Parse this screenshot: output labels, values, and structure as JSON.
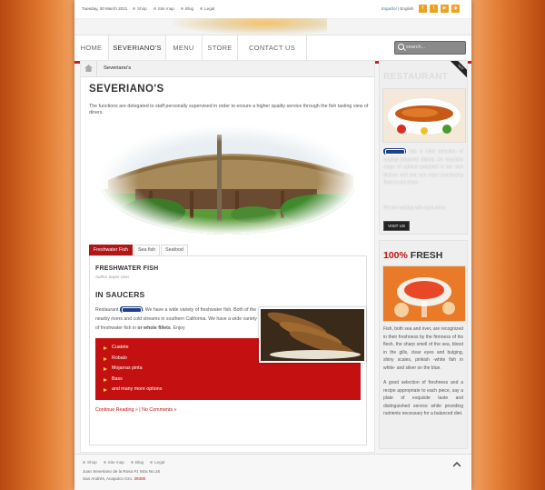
{
  "topbar": {
    "date": "Tuesday, 30 March 2021",
    "links": [
      "Shop",
      "Site map",
      "Blog",
      "Legal"
    ],
    "lang_es": "Español",
    "lang_sep": " | ",
    "lang_en": "English"
  },
  "nav": {
    "items": [
      "HOME",
      "SEVERIANO'S",
      "MENU",
      "STORE",
      "CONTACT US"
    ],
    "search_placeholder": "search..."
  },
  "breadcrumb": {
    "current": "Severiano's"
  },
  "page": {
    "title": "SEVERIANO'S",
    "intro": "The functions are delegated to staff personally supervised in order to ensure a higher quality service through the fish tasting view of diners."
  },
  "tabs": [
    "Freshwater Fish",
    "Sea fish",
    "Seafood"
  ],
  "article": {
    "title": "FRESHWATER FISH",
    "author": "Author Super User",
    "subtitle": "IN SAUCERS",
    "para_prefix": "Restaurant",
    "para_main": ". We have a wide variety of freshwater fish. Both of the nearby rivers and cold streams in southern California. We have a wide variety of freshwater fish in ",
    "para_bold": "or whole fillets",
    "para_end": ". Enjoy",
    "list": [
      "Cuatete",
      "Robalo",
      "Mojarras pinta",
      "Bass",
      "and many more options"
    ],
    "more": "Continue Reading » | No Comments »"
  },
  "sidebar": {
    "box1_title": "RESTAURANT",
    "ribbon": "HOT",
    "box1_text_a": "has a wide selection of varying prepared dishes. An exquisite range of options prepared in our own kitchen and you can enjoy purchasing them in our store.",
    "box1_text_b": "We are waiting with open arms",
    "visit": "VISIT US",
    "box2_title_hl": "100%",
    "box2_title_rest": " FRESH",
    "box2_text_a": "Fish, both sea and river, are recognized in their freshness by the firmness of his flesh, the sharp smell of the sea, blood in the gills, clear eyes and bulging, shiny scales, pinkish -white fish in white- and silver on the blue.",
    "box2_text_b": "A good selection of freshness and a recipe appropriate to each piece, say a plate of exquisite taste and distinguished service while providing nutrients necessary for a balanced diet."
  },
  "footer": {
    "links": [
      "Shop",
      "Site map",
      "Blog",
      "Legal"
    ],
    "address1": "Juan Severiano de la Rosa #1 Mza No.16",
    "address2_a": "San Andrés, Acapulco Gro. ",
    "address2_b": "39380"
  },
  "colors": {
    "accent": "#c41010",
    "nav_border": "#c02020",
    "link_blue": "#3a77b8",
    "social": "#f0a020"
  }
}
